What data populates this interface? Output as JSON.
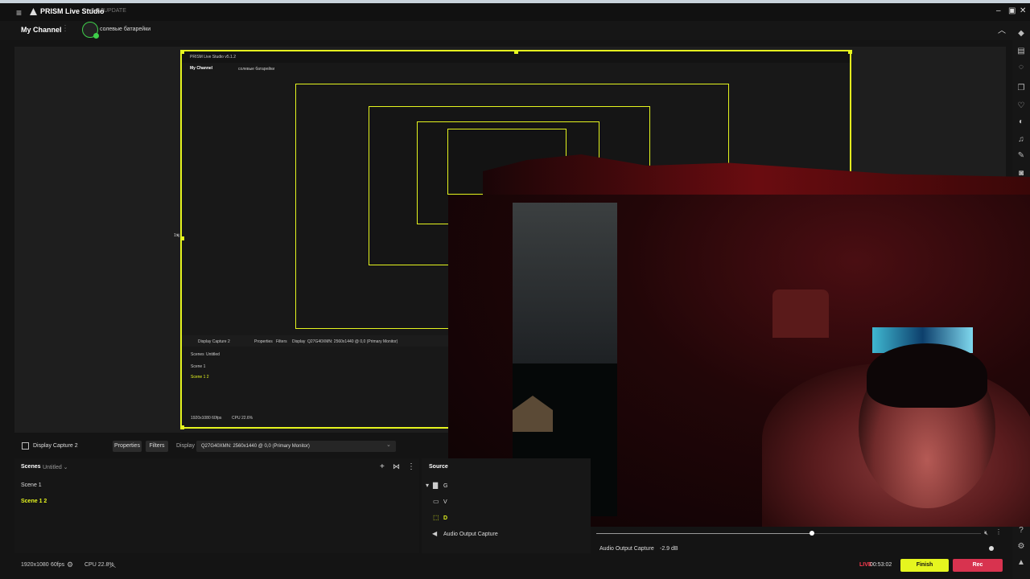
{
  "window": {
    "app_name": "PRISM Live Studio",
    "version": "v5.1.2",
    "update_label": "UPDATE"
  },
  "header": {
    "channel_label": "My Channel",
    "account_name": "солевые батарейки"
  },
  "preview": {
    "nested": {
      "app_name": "PRISM Live Studio v5.1.2",
      "channel_label": "My Channel",
      "account_name": "солевые батарейки",
      "source_label": "Display Capture 2",
      "properties": "Properties",
      "filters": "Filters",
      "display_label": "Display",
      "display_value": "Q27G40XMN: 2560x1440 @ 0,0 (Primary Monitor)",
      "scenes_title": "Scenes",
      "scenes_collection": "Untitled",
      "scene_1": "Scene 1",
      "scene_12": "Scene 1 2",
      "status": "1920x1080  60fps",
      "cpu": "CPU 22.6%",
      "edge_marker": "1ॠ"
    }
  },
  "properties_bar": {
    "source_name": "Display Capture 2",
    "properties_label": "Properties",
    "filters_label": "Filters",
    "display_label": "Display",
    "display_value": "Q27G40XMN: 2560x1440 @ 0,0 (Primary Monitor)"
  },
  "scenes": {
    "title": "Scenes",
    "collection": "Untitled",
    "items": [
      {
        "label": "Scene 1"
      },
      {
        "label": "Scene 1 2"
      }
    ]
  },
  "sources": {
    "title": "Source",
    "rows": [
      {
        "label": "G"
      },
      {
        "label": "V"
      },
      {
        "label": "D"
      },
      {
        "label": "Audio Output Capture"
      }
    ]
  },
  "mixer": {
    "channel": "Audio Output Capture",
    "level": "-2.9 dB",
    "volume": 0.56
  },
  "status": {
    "resolution": "1920x1080",
    "fps": "60fps",
    "cpu": "CPU 22.8%",
    "live_label": "LIVE",
    "elapsed": "00:53:02",
    "finish_label": "Finish",
    "rec_label": "Rec"
  },
  "colors": {
    "accent": "#e5f51f",
    "live": "#ff3b4f",
    "rec": "#d8334f",
    "avatar": "#3ecf4a"
  },
  "icons": [
    "menu-icon",
    "prism-logo-icon",
    "minimize-icon",
    "maximize-icon",
    "close-icon",
    "collapse-icon",
    "settings-gear-icon",
    "chevron-up-icon",
    "add-icon",
    "filter-icon",
    "more-icon",
    "folder-icon",
    "camera-icon",
    "display-icon",
    "speaker-icon",
    "mute-icon"
  ]
}
